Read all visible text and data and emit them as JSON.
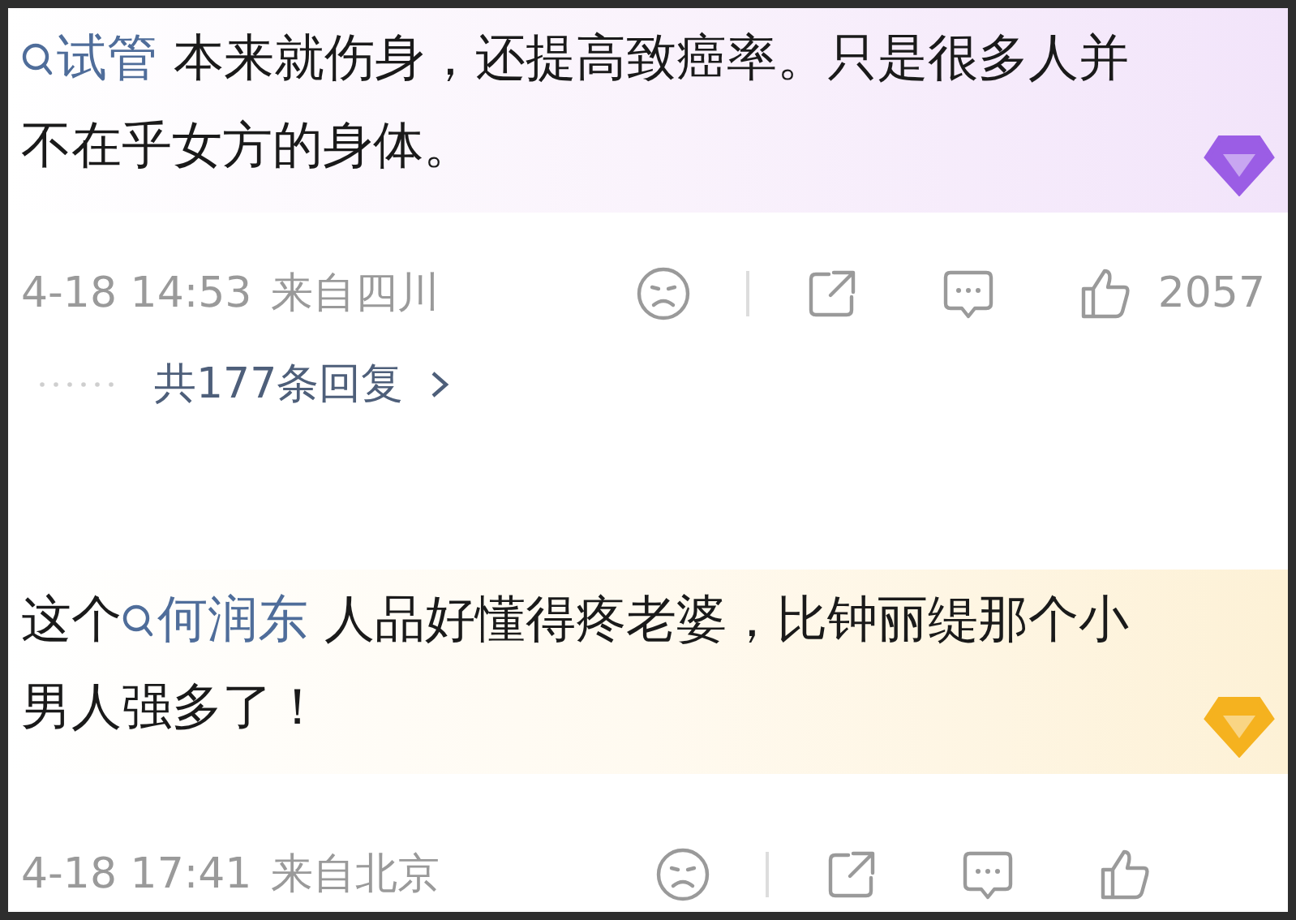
{
  "comments": [
    {
      "color": "#9b5de5",
      "segments": [
        {
          "kind": "link",
          "text": "试管"
        },
        {
          "kind": "text",
          "text": " 本来就伤身，还提高致癌率。只是很多人并不在乎女方的身体。"
        }
      ],
      "time": "4-18 14:53",
      "location": "来自四川",
      "likes": "2057",
      "replies": "共177条回复"
    },
    {
      "color": "#f5b21f",
      "segments": [
        {
          "kind": "text",
          "text": "这个"
        },
        {
          "kind": "link",
          "text": "何润东"
        },
        {
          "kind": "text",
          "text": " 人品好懂得疼老婆，比钟丽缇那个小男人强多了！"
        }
      ],
      "time": "4-18 17:41",
      "location": "来自北京"
    }
  ]
}
